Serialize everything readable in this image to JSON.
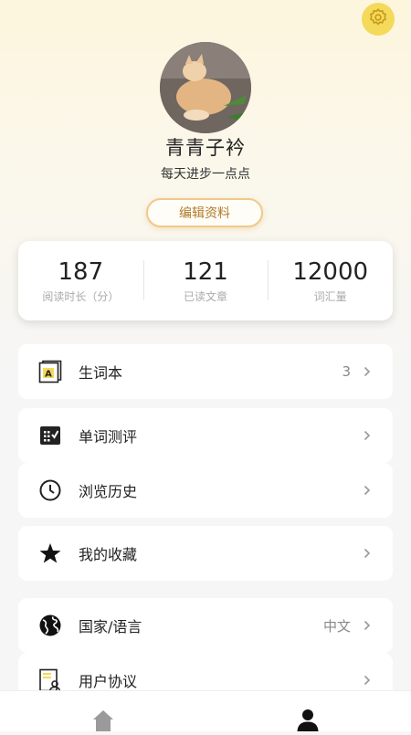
{
  "profile": {
    "name": "青青子衿",
    "bio": "每天进步一点点",
    "edit_label": "编辑资料",
    "avatar_desc": "cat-avatar"
  },
  "stats": [
    {
      "value": "187",
      "label": "阅读时长（分）"
    },
    {
      "value": "121",
      "label": "已读文章"
    },
    {
      "value": "12000",
      "label": "词汇量"
    }
  ],
  "menu": [
    {
      "label": "生词本",
      "value": "3",
      "icon": "vocabulary-book-icon"
    },
    {
      "label": "单词测评",
      "value": "",
      "icon": "word-test-icon"
    },
    {
      "label": "浏览历史",
      "value": "",
      "icon": "clock-icon"
    },
    {
      "label": "我的收藏",
      "value": "",
      "icon": "star-icon"
    },
    {
      "label": "国家/语言",
      "value": "中文",
      "icon": "globe-icon"
    },
    {
      "label": "用户协议",
      "value": "",
      "icon": "user-agreement-icon"
    }
  ],
  "tabbar": {
    "home_icon": "home-icon",
    "profile_icon": "user-icon"
  },
  "colors": {
    "accent": "#f5d95a",
    "edit_border": "#f0c98a",
    "edit_text": "#b07a2a"
  }
}
